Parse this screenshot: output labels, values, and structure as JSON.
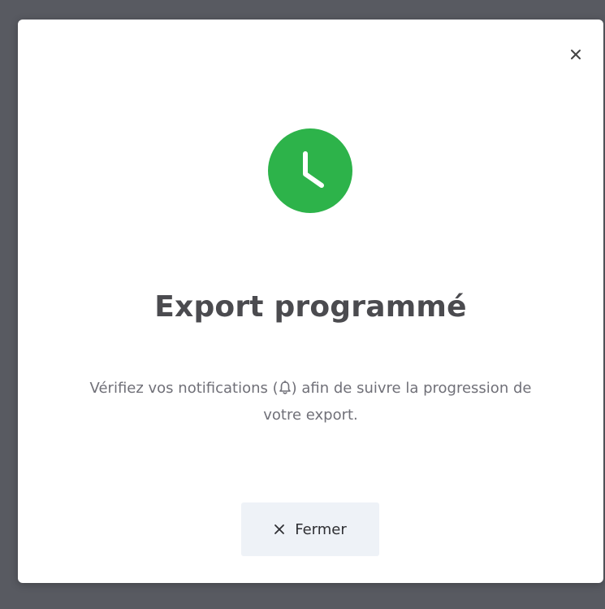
{
  "dialog": {
    "title": "Export programmé",
    "message_before_icon": "Vérifiez vos notifications (",
    "message_icon": "bell-icon",
    "message_after_icon": ") afin de suivre la progression de votre export.",
    "close_button_label": "Fermer",
    "close_icon": "close-icon",
    "status_icon": "clock-icon"
  },
  "colors": {
    "success": "#2db34a",
    "title": "#4b4b4f",
    "message": "#707078",
    "button_bg": "#eef2f7",
    "overlay": "#585a61"
  }
}
